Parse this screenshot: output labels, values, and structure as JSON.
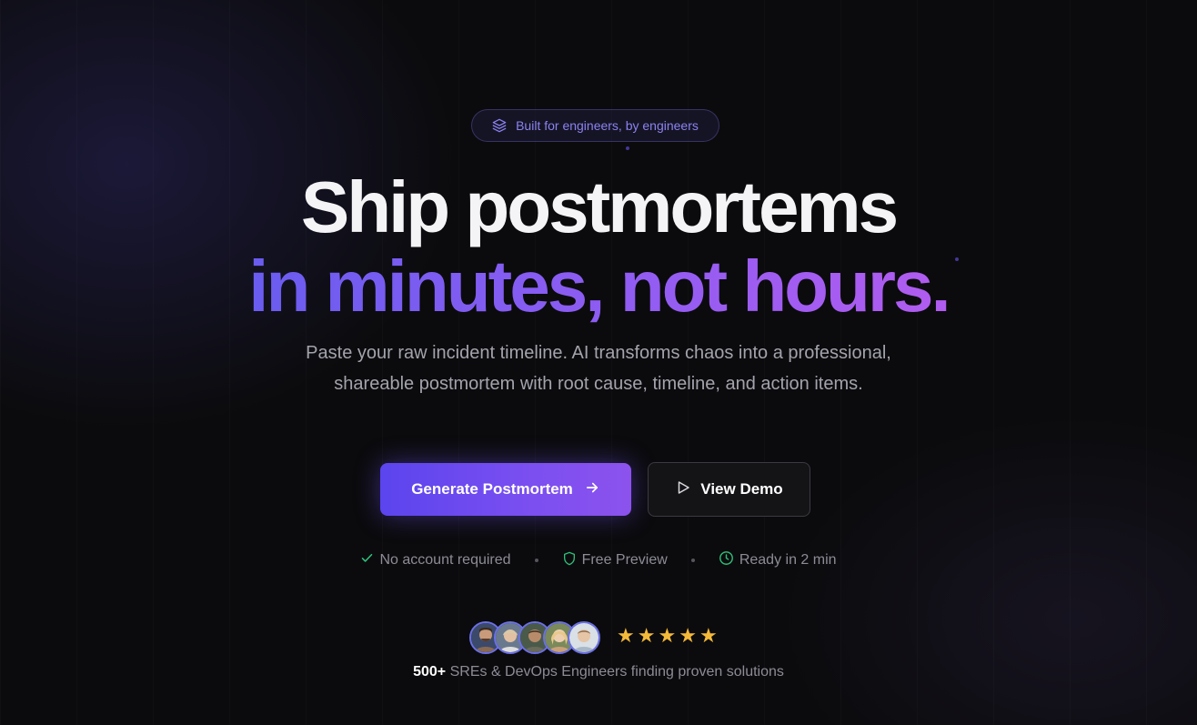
{
  "hero": {
    "badge_text": "Built for engineers, by engineers",
    "headline_line1": "Ship postmortems",
    "headline_line2": "in minutes, not hours.",
    "subtitle": "Paste your raw incident timeline. AI transforms chaos into a professional, shareable postmortem with root cause, timeline, and action items.",
    "primary_cta": "Generate Postmortem",
    "secondary_cta": "View Demo"
  },
  "features": [
    {
      "label": "No account required",
      "icon": "check-icon",
      "color": "#2fbf7a"
    },
    {
      "label": "Free Preview",
      "icon": "shield-icon",
      "color": "#2fbf7a"
    },
    {
      "label": "Ready in 2 min",
      "icon": "clock-icon",
      "color": "#2fbf7a"
    }
  ],
  "social_proof": {
    "count": "500+",
    "text": "SREs & DevOps Engineers finding proven solutions",
    "rating_stars": 5,
    "avatar_count": 5
  },
  "colors": {
    "background": "#0b0b0d",
    "accent": "#7b4ff0",
    "gradient_start": "#6a5cf0",
    "gradient_end": "#b25cf0",
    "star": "#f5b93a"
  }
}
